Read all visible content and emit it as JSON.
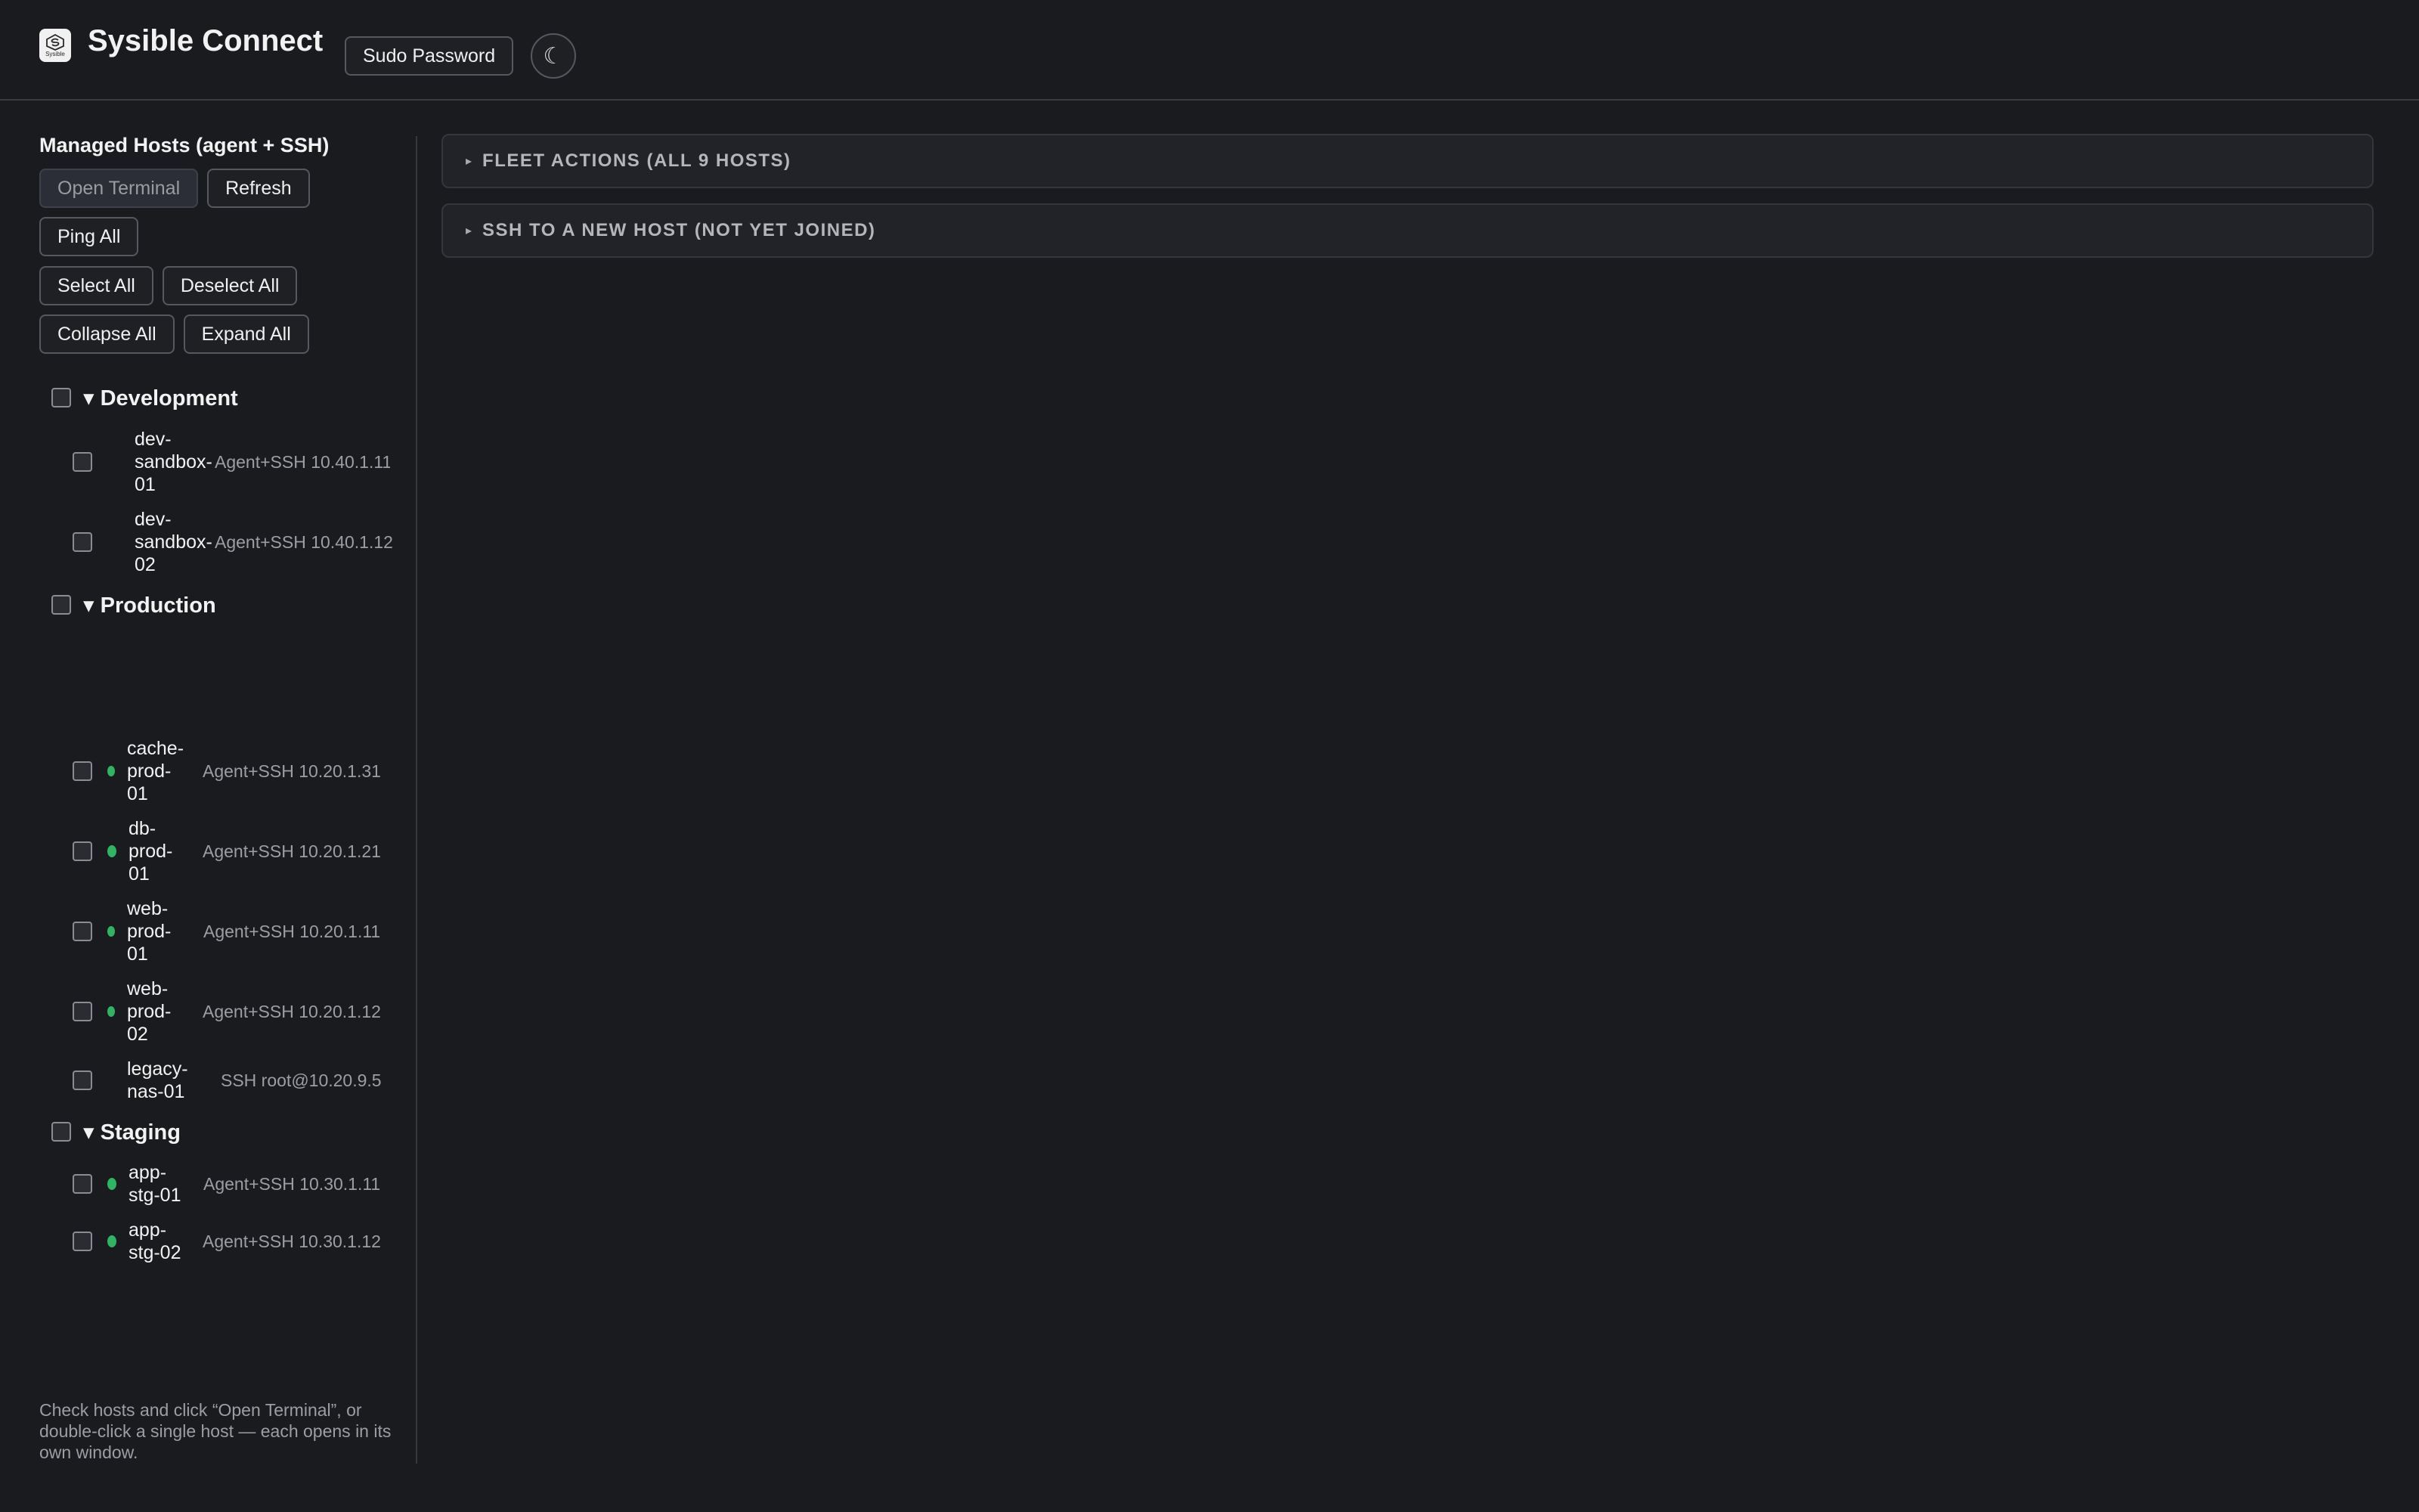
{
  "header": {
    "logo_text": "Sysible",
    "title": "Sysible Connect",
    "sudo_label": "Sudo Password",
    "theme_glyph": "☾"
  },
  "sidebar": {
    "title": "Managed Hosts (agent + SSH)",
    "buttons": {
      "open_terminal": "Open Terminal",
      "refresh": "Refresh",
      "ping_all": "Ping All",
      "select_all": "Select All",
      "deselect_all": "Deselect All",
      "collapse_all": "Collapse All",
      "expand_all": "Expand All"
    },
    "groups": [
      {
        "label": "▾ Development",
        "hosts": [
          {
            "name": "dev-\nsandbox-\n01",
            "meta": "Agent+SSH 10.40.1.11",
            "status": "none"
          },
          {
            "name": "dev-\nsandbox-\n02",
            "meta": "Agent+SSH 10.40.1.12",
            "status": "none"
          }
        ]
      },
      {
        "label": "▾ Production",
        "hosts": [
          {
            "name": "cache-\nprod-\n01",
            "meta": "Agent+SSH 10.20.1.31",
            "status": "online"
          },
          {
            "name": "db-\nprod-\n01",
            "meta": "Agent+SSH 10.20.1.21",
            "status": "online"
          },
          {
            "name": "web-\nprod-\n01",
            "meta": "Agent+SSH 10.20.1.11",
            "status": "online"
          },
          {
            "name": "web-\nprod-\n02",
            "meta": "Agent+SSH 10.20.1.12",
            "status": "online"
          },
          {
            "name": "legacy-\nnas-01",
            "meta": "SSH root@10.20.9.5",
            "status": "none"
          }
        ]
      },
      {
        "label": "▾ Staging",
        "hosts": [
          {
            "name": "app-\nstg-01",
            "meta": "Agent+SSH 10.30.1.11",
            "status": "online"
          },
          {
            "name": "app-\nstg-02",
            "meta": "Agent+SSH 10.30.1.12",
            "status": "online"
          }
        ]
      }
    ],
    "hint": "Check hosts and click “Open Terminal”, or double-click a single host — each opens in its own window."
  },
  "main": {
    "panels": [
      {
        "caret": "▸",
        "label": "FLEET ACTIONS (ALL 9 HOSTS)"
      },
      {
        "caret": "▸",
        "label": "SSH TO A NEW HOST (NOT YET JOINED)"
      }
    ]
  },
  "colors": {
    "background": "#1a1b1e",
    "online": "#2fb463",
    "border": "#55585f"
  }
}
